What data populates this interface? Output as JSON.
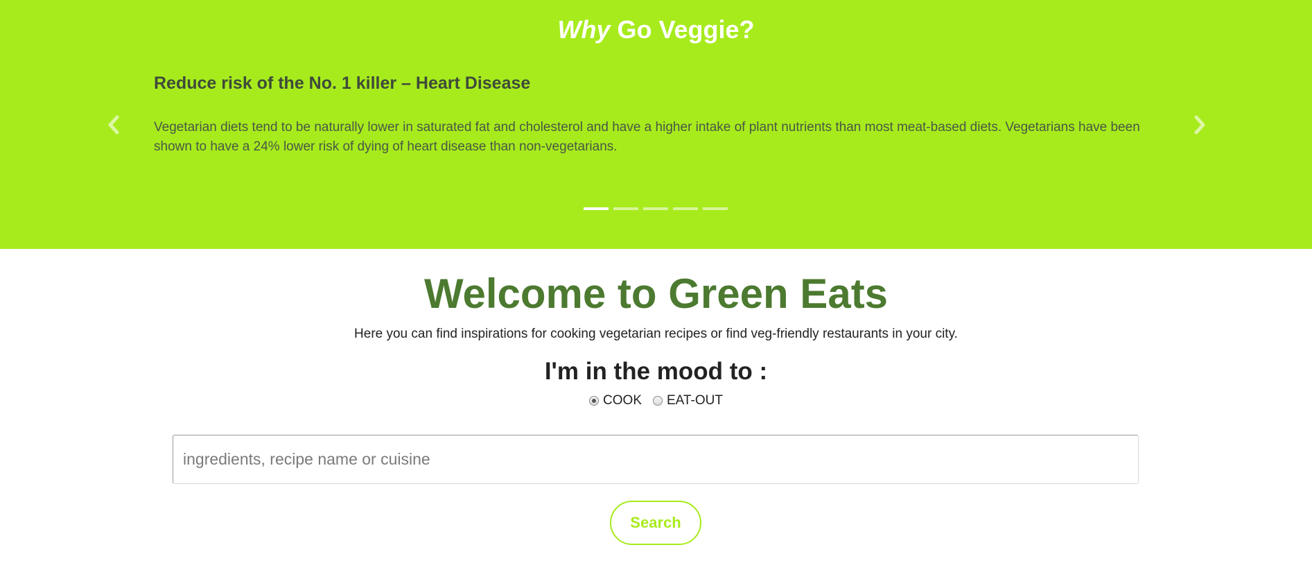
{
  "hero": {
    "title_emphasis": "Why",
    "title_rest": " Go Veggie?",
    "background_color": "#a7eb1d",
    "slide": {
      "heading": "Reduce risk of the No. 1 killer – Heart Disease",
      "text": "Vegetarian diets tend to be naturally lower in saturated fat and cholesterol and have a higher intake of plant nutrients than most meat-based diets. Vegetarians have been shown to have a 24% lower risk of dying of heart disease than non-vegetarians."
    },
    "prev_icon": "chevron-left-icon",
    "next_icon": "chevron-right-icon",
    "indicators": {
      "count": 5,
      "active_index": 0
    }
  },
  "main": {
    "welcome_title": "Welcome to Green Eats",
    "intro": "Here you can find inspirations for cooking vegetarian recipes or find veg-friendly restaurants in your city.",
    "mood_label": "I'm in the mood to :",
    "options": [
      {
        "label": "COOK",
        "checked": true
      },
      {
        "label": "EAT-OUT",
        "checked": false
      }
    ],
    "search": {
      "placeholder": "ingredients, recipe name or cuisine",
      "value": "",
      "button_label": "Search"
    },
    "accent_color": "#a7eb1d",
    "title_color": "#4c7a30"
  }
}
